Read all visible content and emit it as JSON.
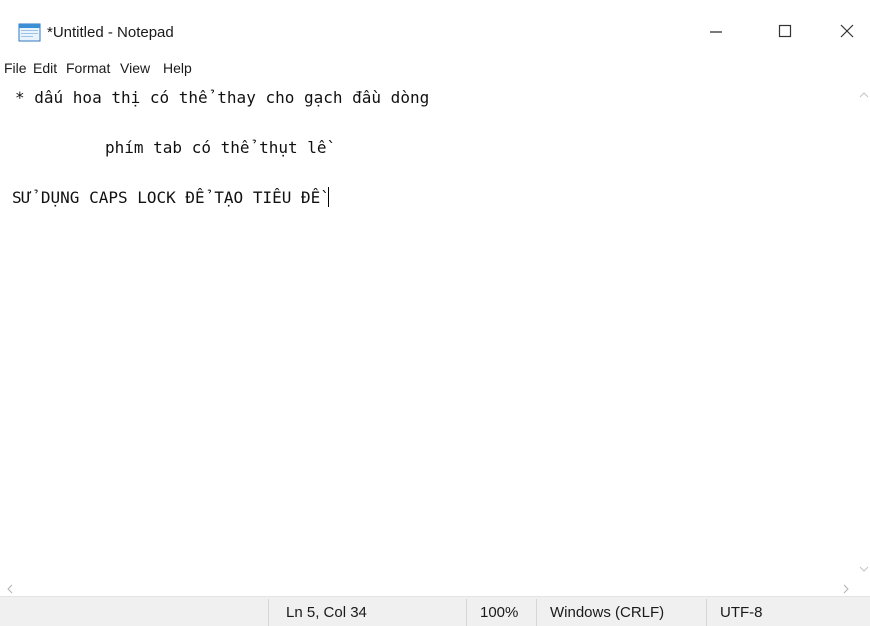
{
  "window": {
    "title": "*Untitled - Notepad",
    "app_icon": "notepad-icon",
    "controls": [
      "minimize-icon",
      "maximize-icon",
      "close-icon"
    ]
  },
  "menu": {
    "items": [
      "File",
      "Edit",
      "Format",
      "View",
      "Help"
    ]
  },
  "editor": {
    "lines": [
      "* dấu hoa thị có thể thay cho gạch đầu dòng",
      "phím tab có thể thụt lề",
      "SỬ DỤNG CAPS LOCK ĐỂ TẠO TIÊU ĐỀ"
    ]
  },
  "status": {
    "position": "Ln 5, Col 34",
    "zoom": "100%",
    "line_endings": "Windows (CRLF)",
    "encoding": "UTF-8"
  },
  "colors": {
    "status_bg": "#f0f0f0",
    "icon_blue": "#3b8fd6"
  }
}
